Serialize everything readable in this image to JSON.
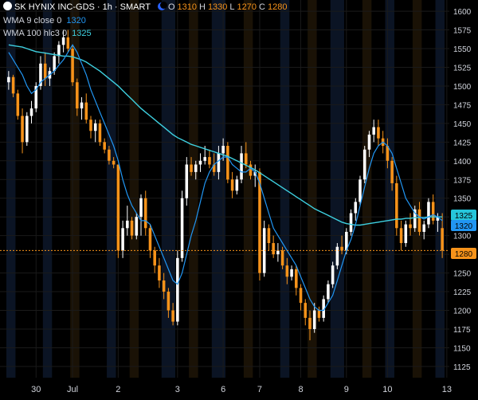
{
  "header": {
    "title": "SK HYNIX INC-GDS · 1h · SMART",
    "ohlc": [
      {
        "label": "O",
        "value": "1310"
      },
      {
        "label": "H",
        "value": "1330"
      },
      {
        "label": "L",
        "value": "1270"
      },
      {
        "label": "C",
        "value": "1280"
      }
    ]
  },
  "indicators": [
    {
      "label": "WMA 9 close 0",
      "value": "1320",
      "color": "#2196f3"
    },
    {
      "label": "WMA 100 hlc3 0",
      "value": "1325",
      "color": "#3ed0e0"
    }
  ],
  "price_tags": [
    {
      "value": "1325",
      "color": "#26c6da"
    },
    {
      "value": "1320",
      "color": "#2196f3"
    },
    {
      "value": "1280",
      "color": "#f7931a"
    }
  ],
  "colors": {
    "up": "#ffffff",
    "down": "#f7931a",
    "background": "#000000",
    "grid": "#1a1a1a",
    "session_blue": "#0b1424",
    "session_orange": "#1a1206"
  },
  "chart_data": {
    "type": "candlestick",
    "ylim": [
      1110,
      1615
    ],
    "y_ticks": [
      1125,
      1150,
      1175,
      1200,
      1225,
      1250,
      1275,
      1300,
      1325,
      1350,
      1375,
      1400,
      1425,
      1450,
      1475,
      1500,
      1525,
      1550,
      1575,
      1600
    ],
    "x_ticks": [
      {
        "label": "30",
        "index": 6
      },
      {
        "label": "Jul",
        "index": 14
      },
      {
        "label": "2",
        "index": 24
      },
      {
        "label": "3",
        "index": 37
      },
      {
        "label": "6",
        "index": 47
      },
      {
        "label": "7",
        "index": 55
      },
      {
        "label": "8",
        "index": 64
      },
      {
        "label": "9",
        "index": 74
      },
      {
        "label": "10",
        "index": 83
      },
      {
        "label": "13",
        "index": 96
      }
    ],
    "candles": [
      [
        1505,
        1520,
        1495,
        1512
      ],
      [
        1512,
        1515,
        1485,
        1490
      ],
      [
        1490,
        1495,
        1455,
        1460
      ],
      [
        1460,
        1470,
        1410,
        1425
      ],
      [
        1425,
        1465,
        1420,
        1460
      ],
      [
        1460,
        1480,
        1450,
        1470
      ],
      [
        1470,
        1505,
        1465,
        1500
      ],
      [
        1500,
        1540,
        1495,
        1530
      ],
      [
        1530,
        1545,
        1500,
        1510
      ],
      [
        1510,
        1525,
        1500,
        1520
      ],
      [
        1520,
        1545,
        1515,
        1540
      ],
      [
        1540,
        1560,
        1530,
        1555
      ],
      [
        1555,
        1575,
        1545,
        1565
      ],
      [
        1565,
        1575,
        1545,
        1550
      ],
      [
        1550,
        1555,
        1500,
        1505
      ],
      [
        1505,
        1510,
        1460,
        1470
      ],
      [
        1470,
        1485,
        1455,
        1478
      ],
      [
        1478,
        1490,
        1450,
        1455
      ],
      [
        1455,
        1460,
        1430,
        1440
      ],
      [
        1440,
        1455,
        1425,
        1450
      ],
      [
        1450,
        1455,
        1420,
        1425
      ],
      [
        1425,
        1430,
        1410,
        1415
      ],
      [
        1415,
        1420,
        1395,
        1400
      ],
      [
        1400,
        1405,
        1390,
        1395
      ],
      [
        1395,
        1395,
        1270,
        1280
      ],
      [
        1280,
        1320,
        1270,
        1310
      ],
      [
        1310,
        1340,
        1300,
        1320
      ],
      [
        1320,
        1325,
        1295,
        1300
      ],
      [
        1300,
        1330,
        1295,
        1325
      ],
      [
        1325,
        1355,
        1300,
        1350
      ],
      [
        1350,
        1360,
        1300,
        1310
      ],
      [
        1310,
        1315,
        1270,
        1280
      ],
      [
        1280,
        1285,
        1250,
        1260
      ],
      [
        1260,
        1270,
        1230,
        1240
      ],
      [
        1240,
        1250,
        1215,
        1225
      ],
      [
        1225,
        1230,
        1190,
        1200
      ],
      [
        1200,
        1210,
        1180,
        1185
      ],
      [
        1185,
        1280,
        1180,
        1270
      ],
      [
        1270,
        1360,
        1265,
        1350
      ],
      [
        1350,
        1405,
        1340,
        1395
      ],
      [
        1395,
        1405,
        1380,
        1385
      ],
      [
        1385,
        1400,
        1375,
        1395
      ],
      [
        1395,
        1410,
        1385,
        1400
      ],
      [
        1400,
        1420,
        1395,
        1405
      ],
      [
        1405,
        1415,
        1390,
        1395
      ],
      [
        1395,
        1410,
        1380,
        1385
      ],
      [
        1385,
        1420,
        1375,
        1410
      ],
      [
        1410,
        1430,
        1400,
        1420
      ],
      [
        1420,
        1425,
        1370,
        1375
      ],
      [
        1375,
        1385,
        1350,
        1360
      ],
      [
        1360,
        1380,
        1355,
        1375
      ],
      [
        1375,
        1420,
        1370,
        1410
      ],
      [
        1410,
        1425,
        1390,
        1395
      ],
      [
        1395,
        1400,
        1375,
        1380
      ],
      [
        1380,
        1395,
        1365,
        1385
      ],
      [
        1385,
        1390,
        1240,
        1250
      ],
      [
        1250,
        1320,
        1245,
        1310
      ],
      [
        1310,
        1315,
        1280,
        1290
      ],
      [
        1290,
        1300,
        1270,
        1275
      ],
      [
        1275,
        1290,
        1265,
        1280
      ],
      [
        1280,
        1285,
        1255,
        1260
      ],
      [
        1260,
        1270,
        1235,
        1245
      ],
      [
        1245,
        1260,
        1240,
        1255
      ],
      [
        1255,
        1260,
        1220,
        1230
      ],
      [
        1230,
        1235,
        1200,
        1210
      ],
      [
        1210,
        1215,
        1180,
        1190
      ],
      [
        1190,
        1200,
        1160,
        1175
      ],
      [
        1175,
        1210,
        1170,
        1200
      ],
      [
        1200,
        1205,
        1185,
        1190
      ],
      [
        1190,
        1220,
        1185,
        1215
      ],
      [
        1215,
        1240,
        1210,
        1235
      ],
      [
        1235,
        1265,
        1230,
        1260
      ],
      [
        1260,
        1290,
        1255,
        1285
      ],
      [
        1285,
        1300,
        1275,
        1280
      ],
      [
        1280,
        1310,
        1275,
        1305
      ],
      [
        1305,
        1335,
        1300,
        1330
      ],
      [
        1330,
        1350,
        1320,
        1345
      ],
      [
        1345,
        1380,
        1340,
        1375
      ],
      [
        1375,
        1420,
        1370,
        1415
      ],
      [
        1415,
        1440,
        1405,
        1435
      ],
      [
        1435,
        1455,
        1425,
        1445
      ],
      [
        1445,
        1455,
        1420,
        1430
      ],
      [
        1430,
        1440,
        1410,
        1420
      ],
      [
        1420,
        1430,
        1390,
        1400
      ],
      [
        1400,
        1405,
        1360,
        1370
      ],
      [
        1370,
        1380,
        1300,
        1310
      ],
      [
        1310,
        1320,
        1280,
        1290
      ],
      [
        1290,
        1320,
        1285,
        1315
      ],
      [
        1315,
        1330,
        1300,
        1310
      ],
      [
        1310,
        1340,
        1305,
        1335
      ],
      [
        1335,
        1345,
        1300,
        1305
      ],
      [
        1305,
        1320,
        1295,
        1315
      ],
      [
        1315,
        1350,
        1310,
        1345
      ],
      [
        1345,
        1355,
        1315,
        1320
      ],
      [
        1320,
        1330,
        1305,
        1325
      ],
      [
        1310,
        1330,
        1270,
        1280
      ]
    ],
    "wma9": [
      1545,
      1535,
      1525,
      1515,
      1500,
      1490,
      1495,
      1505,
      1510,
      1515,
      1520,
      1528,
      1535,
      1545,
      1555,
      1545,
      1530,
      1515,
      1495,
      1480,
      1465,
      1450,
      1435,
      1420,
      1400,
      1375,
      1355,
      1340,
      1330,
      1320,
      1320,
      1315,
      1300,
      1285,
      1270,
      1255,
      1240,
      1235,
      1250,
      1275,
      1300,
      1320,
      1345,
      1370,
      1385,
      1395,
      1400,
      1405,
      1405,
      1395,
      1390,
      1385,
      1385,
      1390,
      1385,
      1370,
      1350,
      1330,
      1310,
      1300,
      1290,
      1280,
      1270,
      1260,
      1245,
      1230,
      1215,
      1205,
      1200,
      1200,
      1210,
      1220,
      1240,
      1260,
      1280,
      1295,
      1315,
      1340,
      1365,
      1390,
      1410,
      1420,
      1425,
      1420,
      1410,
      1390,
      1370,
      1350,
      1340,
      1330,
      1325,
      1322,
      1325,
      1328,
      1325,
      1320
    ],
    "wma100": [
      1555,
      1554,
      1553,
      1552,
      1550,
      1548,
      1546,
      1545,
      1544,
      1543,
      1542,
      1541,
      1540,
      1540,
      1539,
      1537,
      1535,
      1532,
      1528,
      1524,
      1520,
      1515,
      1510,
      1505,
      1500,
      1494,
      1488,
      1482,
      1476,
      1470,
      1465,
      1460,
      1455,
      1450,
      1445,
      1440,
      1435,
      1431,
      1428,
      1425,
      1422,
      1420,
      1418,
      1416,
      1414,
      1412,
      1410,
      1408,
      1406,
      1403,
      1400,
      1397,
      1394,
      1391,
      1388,
      1384,
      1380,
      1376,
      1372,
      1368,
      1364,
      1360,
      1356,
      1352,
      1348,
      1344,
      1340,
      1336,
      1333,
      1330,
      1327,
      1324,
      1321,
      1318,
      1316,
      1315,
      1314,
      1314,
      1315,
      1316,
      1317,
      1318,
      1319,
      1320,
      1321,
      1322,
      1322,
      1323,
      1323,
      1324,
      1324,
      1324,
      1325,
      1325,
      1325,
      1325
    ],
    "sessions": [
      {
        "start": 0,
        "end": 2,
        "kind": "blue"
      },
      {
        "start": 8,
        "end": 10,
        "kind": "blue"
      },
      {
        "start": 14,
        "end": 16,
        "kind": "orange"
      },
      {
        "start": 22,
        "end": 24,
        "kind": "blue"
      },
      {
        "start": 27,
        "end": 29,
        "kind": "orange"
      },
      {
        "start": 34,
        "end": 37,
        "kind": "blue"
      },
      {
        "start": 40,
        "end": 42,
        "kind": "orange"
      },
      {
        "start": 45,
        "end": 48,
        "kind": "blue"
      },
      {
        "start": 52,
        "end": 54,
        "kind": "orange"
      },
      {
        "start": 60,
        "end": 62,
        "kind": "blue"
      },
      {
        "start": 66,
        "end": 68,
        "kind": "orange"
      },
      {
        "start": 71,
        "end": 74,
        "kind": "blue"
      },
      {
        "start": 78,
        "end": 80,
        "kind": "orange"
      },
      {
        "start": 83,
        "end": 85,
        "kind": "blue"
      },
      {
        "start": 89,
        "end": 91,
        "kind": "orange"
      },
      {
        "start": 94,
        "end": 96,
        "kind": "blue"
      }
    ],
    "last_price": 1280
  }
}
